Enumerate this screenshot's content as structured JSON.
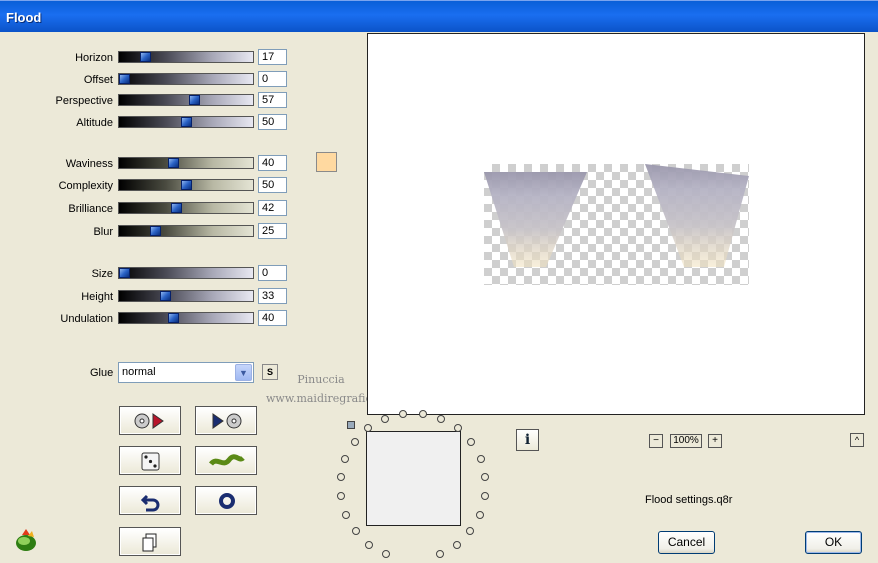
{
  "window": {
    "title": "Flood"
  },
  "sliders": [
    {
      "id": "horizon",
      "label": "Horizon",
      "value": "17",
      "pos": 17
    },
    {
      "id": "offset",
      "label": "Offset",
      "value": "0",
      "pos": 0
    },
    {
      "id": "perspective",
      "label": "Perspective",
      "value": "57",
      "pos": 57
    },
    {
      "id": "altitude",
      "label": "Altitude",
      "value": "50",
      "pos": 50
    },
    {
      "id": "waviness",
      "label": "Waviness",
      "value": "40",
      "pos": 40
    },
    {
      "id": "complexity",
      "label": "Complexity",
      "value": "50",
      "pos": 50
    },
    {
      "id": "brilliance",
      "label": "Brilliance",
      "value": "42",
      "pos": 42
    },
    {
      "id": "blur",
      "label": "Blur",
      "value": "25",
      "pos": 25
    },
    {
      "id": "size",
      "label": "Size",
      "value": "0",
      "pos": 0
    },
    {
      "id": "height",
      "label": "Height",
      "value": "33",
      "pos": 33
    },
    {
      "id": "undulation",
      "label": "Undulation",
      "value": "40",
      "pos": 40
    }
  ],
  "color_swatch": "#ffd9a0",
  "glue": {
    "label": "Glue",
    "value": "normal",
    "s_button": "S"
  },
  "watermark": {
    "line1": "Pinuccia",
    "line2": "www.maidiregrafica.eu"
  },
  "zoom": {
    "minus": "−",
    "value": "100%",
    "plus": "+"
  },
  "up_button": "^",
  "info_button": "i",
  "settings_file": "Flood settings.q8r",
  "buttons": {
    "cancel": "Cancel",
    "ok": "OK"
  },
  "accent_colors": {
    "titlebar": "#0a5fd8",
    "slider_thumb": "#2a62c6"
  }
}
